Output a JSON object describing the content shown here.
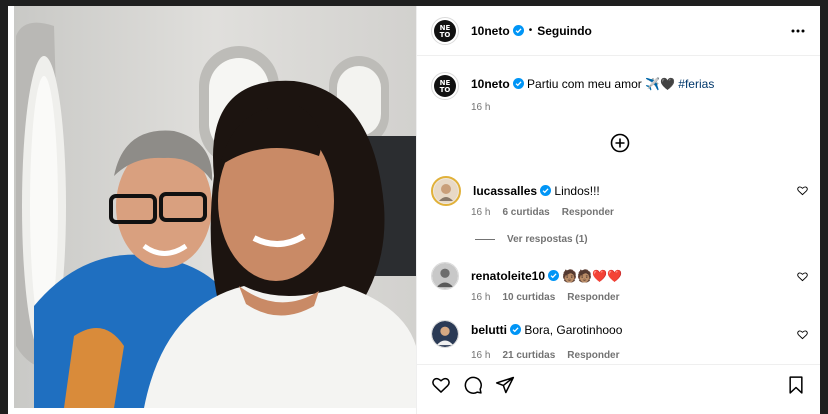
{
  "post": {
    "author": "10neto",
    "follow_status": "Seguindo",
    "separator": "•",
    "caption_text": "Partiu com meu amor ✈️🖤",
    "caption_hashtag": "#ferias",
    "caption_time": "16 h"
  },
  "comments": [
    {
      "user": "lucassalles",
      "text": "Lindos!!!",
      "time": "16 h",
      "likes": "6 curtidas",
      "reply": "Responder",
      "view_replies": "Ver respostas (1)"
    },
    {
      "user": "renatoleite10",
      "text": "🧑🏽🧑🏽❤️❤️",
      "time": "16 h",
      "likes": "10 curtidas",
      "reply": "Responder"
    },
    {
      "user": "belutti",
      "text": "Bora, Garotinhooo",
      "time": "16 h",
      "likes": "21 curtidas",
      "reply": "Responder"
    }
  ],
  "icons": {
    "more": "more-horizontal-icon",
    "add": "plus-circle-icon",
    "like": "heart-outline-icon",
    "comment": "comment-icon",
    "share": "share-icon",
    "save": "bookmark-icon"
  },
  "colors": {
    "verified": "#0095f6",
    "hashtag": "#00376b",
    "muted": "#737373"
  }
}
